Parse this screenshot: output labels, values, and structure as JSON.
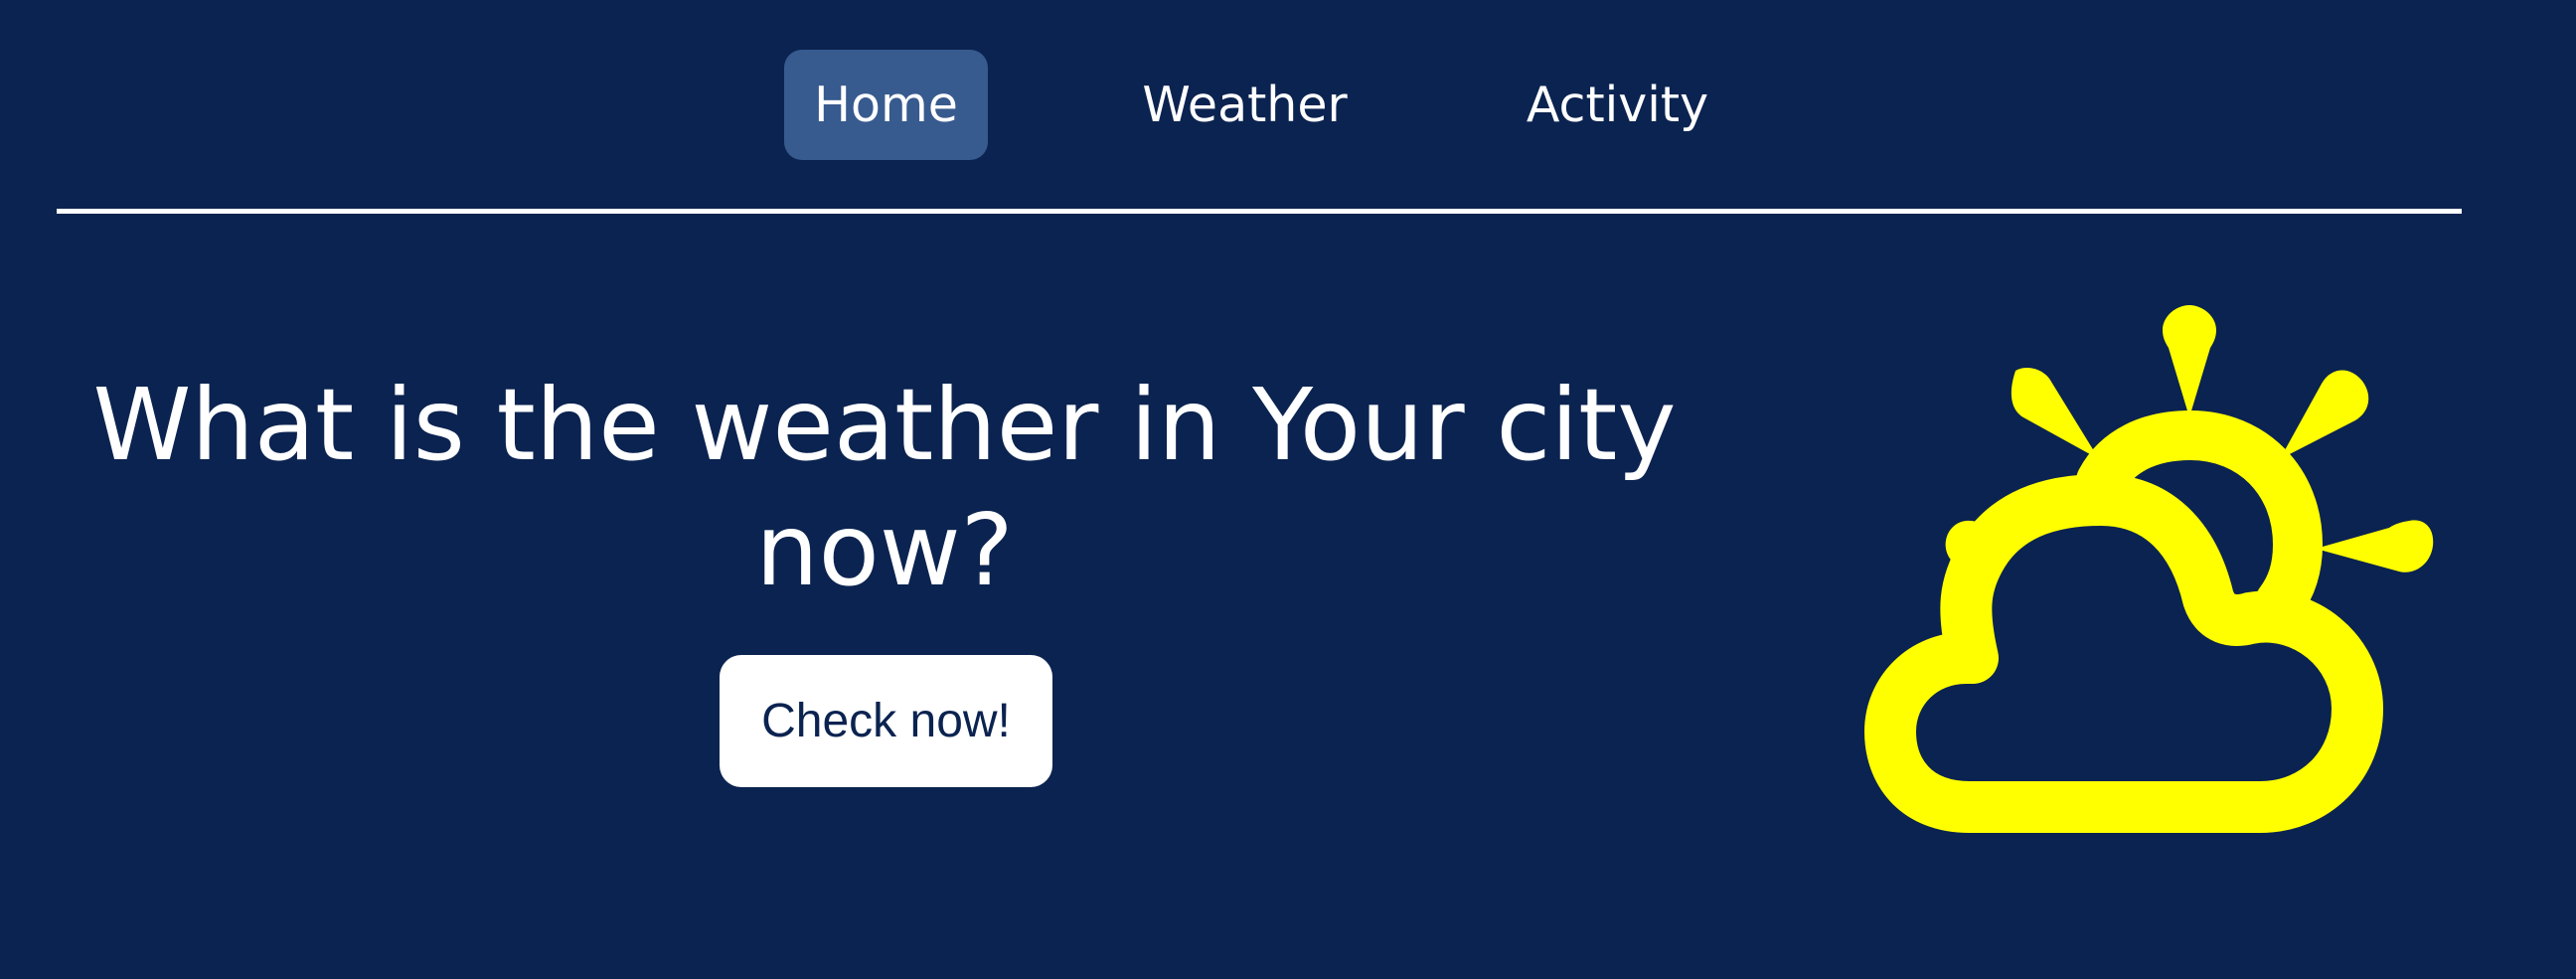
{
  "nav": {
    "items": [
      {
        "label": "Home",
        "active": true
      },
      {
        "label": "Weather",
        "active": false
      },
      {
        "label": "Activity",
        "active": false
      }
    ]
  },
  "hero": {
    "title": "What is the weather in Your city now?",
    "cta_label": "Check now!"
  },
  "illustration": {
    "icon": "partly-cloudy-sun-icon",
    "color": "#ffff00"
  },
  "theme": {
    "background": "#0b2350",
    "active_tab_background": "#375a8f",
    "text": "#ffffff"
  }
}
